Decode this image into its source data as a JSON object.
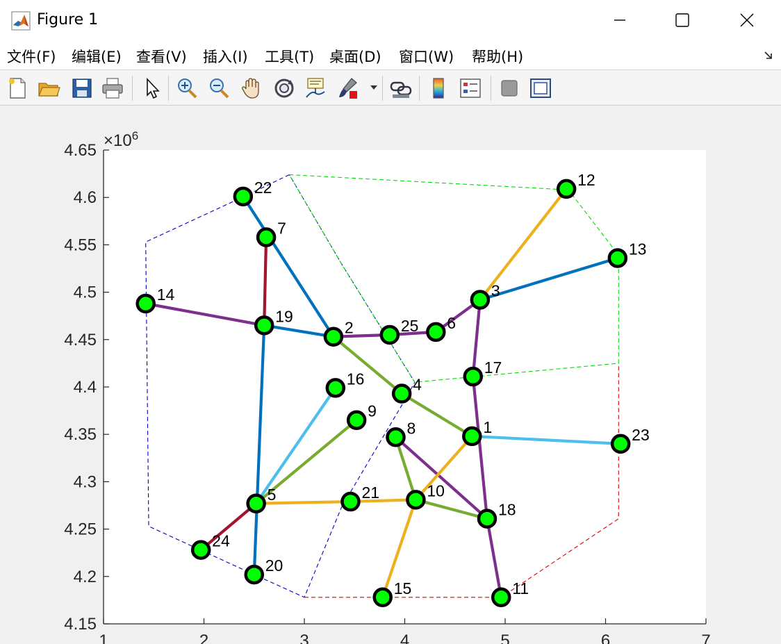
{
  "window": {
    "title": "Figure 1",
    "minimize_icon": "minimize-icon",
    "maximize_icon": "maximize-icon",
    "close_icon": "close-icon",
    "app_icon": "matlab-logo-icon"
  },
  "menu": {
    "items": [
      {
        "label": "文件(F)",
        "mnemonic": "F"
      },
      {
        "label": "编辑(E)",
        "mnemonic": "E"
      },
      {
        "label": "查看(V)",
        "mnemonic": "V"
      },
      {
        "label": "插入(I)",
        "mnemonic": "I"
      },
      {
        "label": "工具(T)",
        "mnemonic": "T"
      },
      {
        "label": "桌面(D)",
        "mnemonic": "D"
      },
      {
        "label": "窗口(W)",
        "mnemonic": "W"
      },
      {
        "label": "帮助(H)",
        "mnemonic": "H"
      }
    ],
    "dock_icon": "dock-arrow-icon"
  },
  "toolbar": {
    "buttons": [
      {
        "icon": "new-figure-icon"
      },
      {
        "icon": "open-file-icon"
      },
      {
        "icon": "save-icon"
      },
      {
        "icon": "print-icon"
      },
      {
        "icon": "edit-plot-arrow-icon"
      },
      {
        "icon": "zoom-in-icon"
      },
      {
        "icon": "zoom-out-icon"
      },
      {
        "icon": "pan-hand-icon"
      },
      {
        "icon": "rotate-3d-icon"
      },
      {
        "icon": "data-cursor-icon"
      },
      {
        "icon": "brush-icon"
      },
      {
        "icon": "link-plot-icon"
      },
      {
        "icon": "colorbar-icon"
      },
      {
        "icon": "legend-icon"
      },
      {
        "icon": "hide-plot-tools-icon"
      },
      {
        "icon": "show-plot-tools-icon"
      }
    ]
  },
  "chart_data": {
    "type": "scatter",
    "title": "",
    "xlabel": "",
    "ylabel": "",
    "y_exponent_label": "×10",
    "y_exponent": "6",
    "xlim": [
      1,
      7
    ],
    "ylim": [
      4.15,
      4.65
    ],
    "y_scale_factor": 1000000,
    "xticks": [
      "1",
      "2",
      "3",
      "4",
      "5",
      "6",
      "7"
    ],
    "yticks": [
      "4.15",
      "4.2",
      "4.25",
      "4.3",
      "4.35",
      "4.4",
      "4.45",
      "4.5",
      "4.55",
      "4.6",
      "4.65"
    ],
    "grid": false,
    "node_color": "#00ff00",
    "node_edge_color": "#000000",
    "nodes": [
      {
        "id": "1",
        "x": 4.67,
        "y": 4.348
      },
      {
        "id": "2",
        "x": 3.29,
        "y": 4.453
      },
      {
        "id": "3",
        "x": 4.75,
        "y": 4.492
      },
      {
        "id": "4",
        "x": 3.97,
        "y": 4.393
      },
      {
        "id": "5",
        "x": 2.52,
        "y": 4.277
      },
      {
        "id": "6",
        "x": 4.31,
        "y": 4.458
      },
      {
        "id": "7",
        "x": 2.62,
        "y": 4.558
      },
      {
        "id": "8",
        "x": 3.91,
        "y": 4.347
      },
      {
        "id": "9",
        "x": 3.52,
        "y": 4.365
      },
      {
        "id": "10",
        "x": 4.11,
        "y": 4.281
      },
      {
        "id": "11",
        "x": 4.96,
        "y": 4.178
      },
      {
        "id": "12",
        "x": 5.61,
        "y": 4.609
      },
      {
        "id": "13",
        "x": 6.12,
        "y": 4.536
      },
      {
        "id": "14",
        "x": 1.42,
        "y": 4.488
      },
      {
        "id": "15",
        "x": 3.78,
        "y": 4.178
      },
      {
        "id": "16",
        "x": 3.31,
        "y": 4.399
      },
      {
        "id": "17",
        "x": 4.68,
        "y": 4.411
      },
      {
        "id": "18",
        "x": 4.82,
        "y": 4.261
      },
      {
        "id": "19",
        "x": 2.6,
        "y": 4.465
      },
      {
        "id": "20",
        "x": 2.5,
        "y": 4.202
      },
      {
        "id": "21",
        "x": 3.46,
        "y": 4.279
      },
      {
        "id": "22",
        "x": 2.39,
        "y": 4.601
      },
      {
        "id": "23",
        "x": 6.15,
        "y": 4.34
      },
      {
        "id": "24",
        "x": 1.97,
        "y": 4.228
      },
      {
        "id": "25",
        "x": 3.85,
        "y": 4.455
      }
    ],
    "edges": [
      {
        "from": "22",
        "to": "2",
        "color": "#0072bd"
      },
      {
        "from": "19",
        "to": "2",
        "color": "#0072bd"
      },
      {
        "from": "3",
        "to": "13",
        "color": "#0072bd"
      },
      {
        "from": "19",
        "to": "20",
        "color": "#0072bd"
      },
      {
        "from": "7",
        "to": "19",
        "color": "#a2142f"
      },
      {
        "from": "5",
        "to": "24",
        "color": "#a2142f"
      },
      {
        "from": "14",
        "to": "19",
        "color": "#7e2f8e"
      },
      {
        "from": "2",
        "to": "25",
        "color": "#7e2f8e"
      },
      {
        "from": "25",
        "to": "6",
        "color": "#7e2f8e"
      },
      {
        "from": "6",
        "to": "3",
        "color": "#7e2f8e"
      },
      {
        "from": "3",
        "to": "17",
        "color": "#7e2f8e"
      },
      {
        "from": "17",
        "to": "18",
        "color": "#7e2f8e"
      },
      {
        "from": "18",
        "to": "11",
        "color": "#7e2f8e"
      },
      {
        "from": "8",
        "to": "18",
        "color": "#7e2f8e"
      },
      {
        "from": "3",
        "to": "12",
        "color": "#edb120"
      },
      {
        "from": "5",
        "to": "21",
        "color": "#edb120"
      },
      {
        "from": "21",
        "to": "10",
        "color": "#edb120"
      },
      {
        "from": "10",
        "to": "1",
        "color": "#edb120"
      },
      {
        "from": "10",
        "to": "15",
        "color": "#edb120"
      },
      {
        "from": "2",
        "to": "4",
        "color": "#77ac30"
      },
      {
        "from": "4",
        "to": "1",
        "color": "#77ac30"
      },
      {
        "from": "5",
        "to": "9",
        "color": "#77ac30"
      },
      {
        "from": "8",
        "to": "10",
        "color": "#77ac30"
      },
      {
        "from": "10",
        "to": "18",
        "color": "#77ac30"
      },
      {
        "from": "5",
        "to": "16",
        "color": "#4dbeee"
      },
      {
        "from": "1",
        "to": "23",
        "color": "#4dbeee"
      }
    ],
    "regions": [
      {
        "name": "blue-region",
        "color": "#0000cc",
        "points": [
          [
            2.85,
            4.624
          ],
          [
            2.4,
            4.601
          ],
          [
            1.42,
            4.553
          ],
          [
            1.45,
            4.253
          ],
          [
            2.5,
            4.202
          ],
          [
            3.0,
            4.178
          ],
          [
            3.37,
            4.273
          ],
          [
            4.0,
            4.386
          ],
          [
            4.1,
            4.405
          ],
          [
            3.37,
            4.53
          ],
          [
            2.85,
            4.624
          ]
        ]
      },
      {
        "name": "green-region",
        "color": "#00dd00",
        "points": [
          [
            2.85,
            4.624
          ],
          [
            5.63,
            4.608
          ],
          [
            6.08,
            4.546
          ],
          [
            6.13,
            4.536
          ],
          [
            6.13,
            4.425
          ],
          [
            4.1,
            4.405
          ],
          [
            3.37,
            4.53
          ],
          [
            2.85,
            4.624
          ]
        ]
      },
      {
        "name": "red-region",
        "color": "#dd0000",
        "points": [
          [
            3.0,
            4.178
          ],
          [
            4.96,
            4.178
          ],
          [
            6.13,
            4.261
          ],
          [
            6.13,
            4.425
          ]
        ]
      }
    ]
  }
}
